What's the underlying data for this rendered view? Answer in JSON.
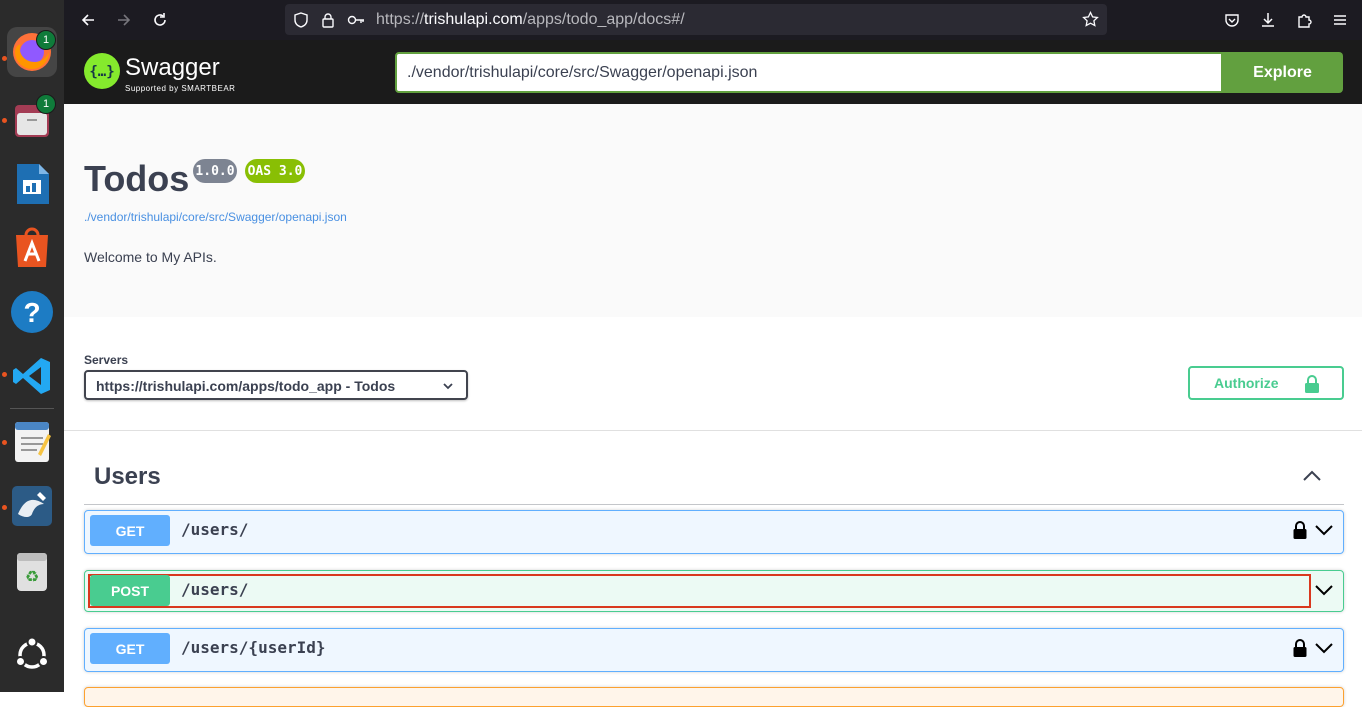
{
  "dock": {
    "apps": [
      {
        "name": "firefox",
        "badge": "1"
      },
      {
        "name": "files",
        "badge": "1"
      },
      {
        "name": "libreoffice-impress",
        "badge": ""
      },
      {
        "name": "app-center",
        "badge": ""
      },
      {
        "name": "help",
        "badge": ""
      },
      {
        "name": "vscode",
        "badge": ""
      },
      {
        "name": "text-editor",
        "badge": ""
      },
      {
        "name": "mysql-workbench",
        "badge": ""
      },
      {
        "name": "trash",
        "badge": ""
      },
      {
        "name": "show-apps",
        "badge": ""
      }
    ]
  },
  "browser": {
    "url_prefix": "https://",
    "url_host": "trishulapi.com",
    "url_path": "/apps/todo_app/docs#/"
  },
  "swagger": {
    "brand": "Swagger",
    "brand_sub": "Supported by SMARTBEAR",
    "spec_url": "./vendor/trishulapi/core/src/Swagger/openapi.json",
    "explore_label": "Explore"
  },
  "info": {
    "title": "Todos",
    "version": "1.0.0",
    "oas": "OAS 3.0",
    "spec_link": "./vendor/trishulapi/core/src/Swagger/openapi.json",
    "description": "Welcome to My APIs."
  },
  "servers": {
    "label": "Servers",
    "selected": "https://trishulapi.com/apps/todo_app - Todos",
    "authorize_label": "Authorize"
  },
  "tag": {
    "name": "Users",
    "operations": [
      {
        "method": "GET",
        "path": "/users/",
        "locked": true
      },
      {
        "method": "POST",
        "path": "/users/",
        "locked": false
      },
      {
        "method": "GET",
        "path": "/users/{userId}",
        "locked": true
      }
    ]
  },
  "colors": {
    "get": "#61affe",
    "post": "#49cc90",
    "put": "#fca130",
    "explore": "#62a03f",
    "swagger_green": "#85ea2d"
  }
}
